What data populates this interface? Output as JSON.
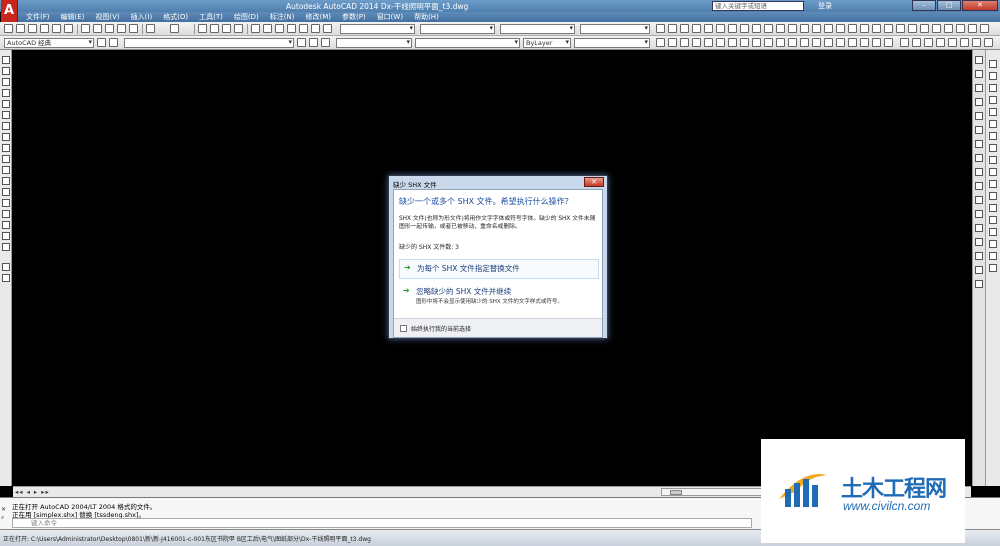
{
  "window": {
    "app_letter": "A",
    "title": "Autodesk AutoCAD 2014    Dx-干线照明平面_t3.dwg",
    "search_placeholder": "键入关键字或短语",
    "login": "登录",
    "minimize": "–",
    "maximize": "□",
    "close": "✕"
  },
  "menu": [
    "文件(F)",
    "编辑(E)",
    "视图(V)",
    "插入(I)",
    "格式(O)",
    "工具(T)",
    "绘图(D)",
    "标注(N)",
    "修改(M)",
    "参数(P)",
    "窗口(W)",
    "帮助(H)"
  ],
  "toolbar": {
    "workspace": "AutoCAD 经典",
    "linetype": "ByLayer"
  },
  "dialog": {
    "title": "缺少 SHX 文件",
    "close": "✕",
    "heading": "缺少一个或多个 SHX 文件。希望执行什么操作？",
    "description": "SHX 文件(也称为形文件)将用作文字字体或符号字体。缺少的 SHX 文件未随图形一起传输，或者已被移动、重命名或删除。",
    "missing_count": "缺少的 SHX 文件数: 3",
    "option1_label": "为每个 SHX 文件指定替换文件",
    "option2_label": "忽略缺少的 SHX 文件并继续",
    "option2_sub": "图形中将不会显示使用缺少的 SHX 文件的文字样式或符号。",
    "checkbox_label": "始终执行我的当前选择",
    "arrow": "➔"
  },
  "bottom": {
    "tab_nav": "◂◂ ◂ ▸ ▸▸"
  },
  "command": {
    "line1": "正在打开 AutoCAD 2004/LT 2004 格式的文件。",
    "line2": "正在用 [simplex.shx] 替换 [tssdeng.shx]。",
    "input_placeholder": "键入命令"
  },
  "status": {
    "text": "正在打开: C:\\Users\\Administrator\\Desktop\\0801\\新\\新-J416001-c-001东区书院甲 B区工后\\电气\\图纸部分\\Dx-干线照明平面_t3.dwg"
  },
  "watermark": {
    "title": "土木工程网",
    "url": "www.civilcn.com"
  }
}
